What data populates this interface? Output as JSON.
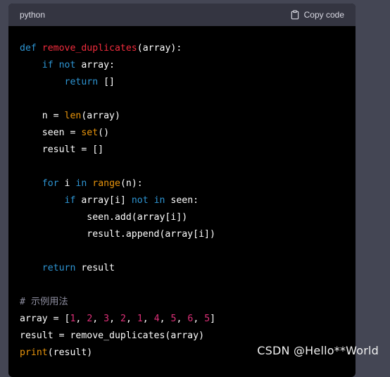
{
  "header": {
    "language": "python",
    "copy_label": "Copy code"
  },
  "code_lines": [
    [
      [
        "kw",
        "def "
      ],
      [
        "fn",
        "remove_duplicates"
      ],
      [
        "t",
        "(array):"
      ]
    ],
    [
      [
        "t",
        "    "
      ],
      [
        "kw",
        "if not "
      ],
      [
        "t",
        "array:"
      ]
    ],
    [
      [
        "t",
        "        "
      ],
      [
        "kw",
        "return "
      ],
      [
        "t",
        "[]"
      ]
    ],
    [],
    [
      [
        "t",
        "    n = "
      ],
      [
        "bi",
        "len"
      ],
      [
        "t",
        "(array)"
      ]
    ],
    [
      [
        "t",
        "    seen = "
      ],
      [
        "bi",
        "set"
      ],
      [
        "t",
        "()"
      ]
    ],
    [
      [
        "t",
        "    result = []"
      ]
    ],
    [],
    [
      [
        "t",
        "    "
      ],
      [
        "kw",
        "for "
      ],
      [
        "t",
        "i "
      ],
      [
        "kw",
        "in "
      ],
      [
        "bi",
        "range"
      ],
      [
        "t",
        "(n):"
      ]
    ],
    [
      [
        "t",
        "        "
      ],
      [
        "kw",
        "if "
      ],
      [
        "t",
        "array[i] "
      ],
      [
        "kw",
        "not in "
      ],
      [
        "t",
        "seen:"
      ]
    ],
    [
      [
        "t",
        "            seen.add(array[i])"
      ]
    ],
    [
      [
        "t",
        "            result.append(array[i])"
      ]
    ],
    [],
    [
      [
        "t",
        "    "
      ],
      [
        "kw",
        "return "
      ],
      [
        "t",
        "result"
      ]
    ],
    [],
    [
      [
        "cm",
        "# 示例用法"
      ]
    ],
    [
      [
        "t",
        "array = ["
      ],
      [
        "num",
        "1"
      ],
      [
        "t",
        ", "
      ],
      [
        "num",
        "2"
      ],
      [
        "t",
        ", "
      ],
      [
        "num",
        "3"
      ],
      [
        "t",
        ", "
      ],
      [
        "num",
        "2"
      ],
      [
        "t",
        ", "
      ],
      [
        "num",
        "1"
      ],
      [
        "t",
        ", "
      ],
      [
        "num",
        "4"
      ],
      [
        "t",
        ", "
      ],
      [
        "num",
        "5"
      ],
      [
        "t",
        ", "
      ],
      [
        "num",
        "6"
      ],
      [
        "t",
        ", "
      ],
      [
        "num",
        "5"
      ],
      [
        "t",
        "]"
      ]
    ],
    [
      [
        "t",
        "result = remove_duplicates(array)"
      ]
    ],
    [
      [
        "bi",
        "print"
      ],
      [
        "t",
        "(result)"
      ]
    ]
  ],
  "watermark": "CSDN @Hello**World",
  "colors": {
    "page_bg": "#444654",
    "code_bg": "#000000",
    "header_bg": "#343541",
    "keyword": "#2e95d3",
    "function": "#f22c3d",
    "builtin": "#e9950c",
    "number": "#df3079",
    "comment": "#8e8ea0"
  },
  "icons": {
    "copy": "clipboard-icon"
  }
}
